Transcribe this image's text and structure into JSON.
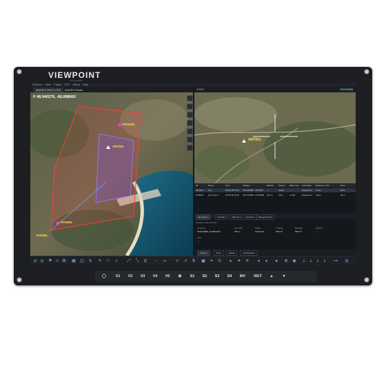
{
  "brand": {
    "logo": "VIEWPOINT",
    "sub": "SYSTEMS"
  },
  "screen": {
    "menu": [
      "Window",
      "View",
      "Player",
      "SVT",
      "Setup",
      "Help"
    ],
    "map_tabs": [
      "MAKEO 10k B LOW",
      "MAKEO Radar"
    ],
    "coordinates": "P 48.940279, -66.898063",
    "map_labels": {
      "pos": "POSS00",
      "art": "ART001",
      "pos2": "POS001",
      "avg": "AVG001"
    },
    "video": {
      "title": "VIDEO",
      "mode": "TACVISION",
      "target_label": "ART001"
    },
    "table": {
      "headers": [
        "ID",
        "Name",
        "Time",
        "Position",
        "Altitude",
        "Source",
        "Path Loss",
        "Hold State",
        "Distance to Go",
        "Error"
      ],
      "rows": [
        [
          "ART001",
          "Pos",
          "03:09:15:54:32",
          "48.9129082, -66.8993",
          "—",
          "Target",
          "—",
          "Registered",
          "Know",
          "Error"
        ],
        [
          "POS001",
          "Pos Team 1",
          "03:08:11:02:49",
          "48.9719380, -66.84880",
          "150 m",
          "GPS",
          "+0 dB",
          "Registered",
          "Know",
          "55 m"
        ]
      ]
    },
    "subtabs": [
      "All Tracks 4",
      "Friendly 2",
      "Manual 4",
      "Checked",
      "Merged Tracks"
    ],
    "details": {
      "header": "Acquisition Artillery ART001",
      "fields": [
        {
          "label": "POSITION",
          "value": "48.9129082, -66.8921611"
        },
        {
          "label": "ALTITUDE",
          "value": "160 m"
        },
        {
          "label": "SPEED",
          "value": "0.00 km/h"
        },
        {
          "label": "COURSE",
          "value": "000° M"
        },
        {
          "label": "BEARING",
          "value": "000° M"
        },
        {
          "label": "SOURCE",
          "value": "—"
        }
      ],
      "extra_label": "TIME",
      "extra_value": "—"
    },
    "bottom_tabs": [
      "Position",
      "Extra",
      "Media",
      "Classification"
    ]
  },
  "buttons": [
    "V1",
    "V2",
    "V3",
    "V4",
    "V5",
    "S1",
    "S2",
    "S3",
    "S4",
    "MV",
    "NGT",
    "▲",
    "▼"
  ],
  "colors": {
    "bezel": "#1c1e21",
    "polygon": "#ff3b3b",
    "label": "#ffe34a",
    "screen_bg": "#15181c"
  }
}
